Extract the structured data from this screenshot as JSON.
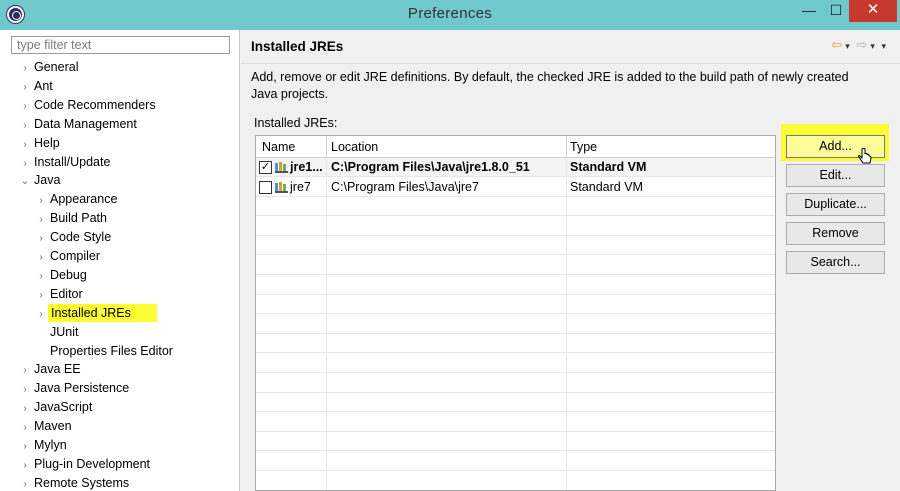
{
  "window": {
    "title": "Preferences",
    "minimize_label": "—",
    "maximize_label": "☐",
    "close_label": "✕"
  },
  "filter": {
    "placeholder": "type filter text",
    "value": ""
  },
  "tree": [
    {
      "label": "General",
      "arrow": "›"
    },
    {
      "label": "Ant",
      "arrow": "›"
    },
    {
      "label": "Code Recommenders",
      "arrow": "›"
    },
    {
      "label": "Data Management",
      "arrow": "›"
    },
    {
      "label": "Help",
      "arrow": "›"
    },
    {
      "label": "Install/Update",
      "arrow": "›"
    },
    {
      "label": "Java",
      "arrow": "⌄"
    },
    {
      "label": "Appearance",
      "arrow": "›"
    },
    {
      "label": "Build Path",
      "arrow": "›"
    },
    {
      "label": "Code Style",
      "arrow": "›"
    },
    {
      "label": "Compiler",
      "arrow": "›"
    },
    {
      "label": "Debug",
      "arrow": "›"
    },
    {
      "label": "Editor",
      "arrow": "›"
    },
    {
      "label": "Installed JREs",
      "arrow": "›"
    },
    {
      "label": "JUnit",
      "arrow": ""
    },
    {
      "label": "Properties Files Editor",
      "arrow": ""
    },
    {
      "label": "Java EE",
      "arrow": "›"
    },
    {
      "label": "Java Persistence",
      "arrow": "›"
    },
    {
      "label": "JavaScript",
      "arrow": "›"
    },
    {
      "label": "Maven",
      "arrow": "›"
    },
    {
      "label": "Mylyn",
      "arrow": "›"
    },
    {
      "label": "Plug-in Development",
      "arrow": "›"
    },
    {
      "label": "Remote Systems",
      "arrow": "›"
    }
  ],
  "page": {
    "title": "Installed JREs",
    "description": "Add, remove or edit JRE definitions. By default, the checked JRE is added to the build path of newly created Java projects.",
    "table_label": "Installed JREs:",
    "nav": {
      "back": "⇦",
      "back_menu": "▾",
      "forward": "⇨",
      "forward_menu": "▾",
      "view_menu": "▾"
    }
  },
  "table": {
    "columns": [
      "Name",
      "Location",
      "Type"
    ],
    "rows": [
      {
        "checked": true,
        "check_mark": "✓",
        "name": "jre1...",
        "location": "C:\\Program Files\\Java\\jre1.8.0_51",
        "type": "Standard VM"
      },
      {
        "checked": false,
        "check_mark": "",
        "name": "jre7",
        "location": "C:\\Program Files\\Java\\jre7",
        "type": "Standard VM"
      }
    ]
  },
  "buttons": {
    "add": "Add...",
    "edit": "Edit...",
    "duplicate": "Duplicate...",
    "remove": "Remove",
    "search": "Search..."
  },
  "colors": {
    "titlebar": "#6fc8cc",
    "highlight": "#fdfd33",
    "close": "#c7382f"
  }
}
